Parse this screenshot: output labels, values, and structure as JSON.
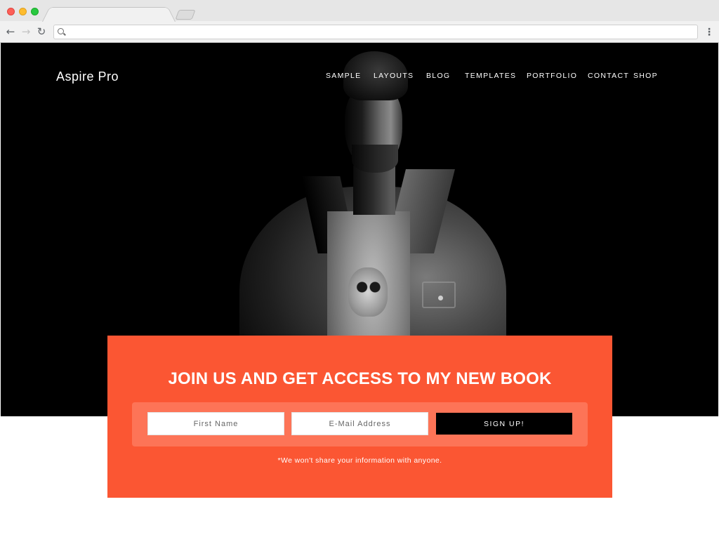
{
  "browser": {
    "url": "",
    "tab_title": ""
  },
  "site": {
    "title": "Aspire Pro",
    "nav": [
      "SAMPLE",
      "LAYOUTS",
      "BLOG",
      "TEMPLATES",
      "PORTFOLIO",
      "CONTACT",
      "SHOP"
    ]
  },
  "signup": {
    "heading": "JOIN US AND GET ACCESS TO MY NEW BOOK",
    "first_name_placeholder": "First Name",
    "email_placeholder": "E-Mail Address",
    "button_label": "SIGN UP!",
    "disclaimer": "*We won't share your information with anyone."
  },
  "colors": {
    "accent": "#fb5633",
    "hero_background": "#000000",
    "button": "#000000"
  }
}
